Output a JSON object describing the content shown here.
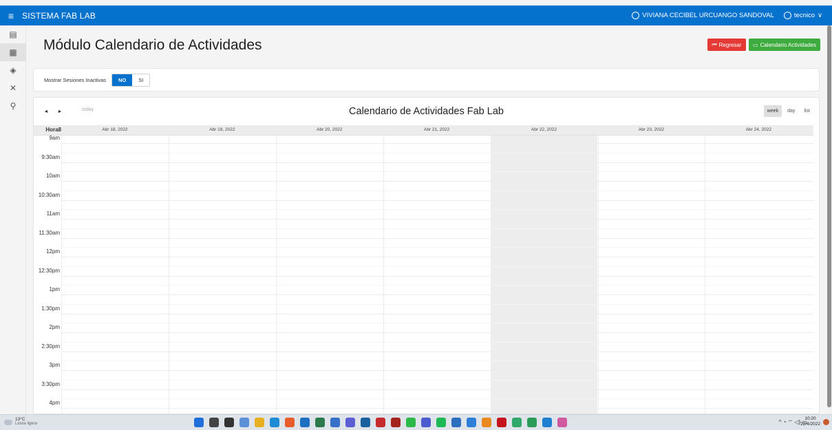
{
  "header": {
    "menu_icon": "menu-icon",
    "app_title": "SISTEMA FAB LAB",
    "user_full_name": "VIVIANA CECIBEL URCUANGO SANDOVAL",
    "user_name": "tecnico",
    "chevron": "∨"
  },
  "sidenav": {
    "items": [
      {
        "icon": "home-icon"
      },
      {
        "icon": "list-icon"
      },
      {
        "icon": "layers-icon"
      },
      {
        "icon": "tools-icon"
      },
      {
        "icon": "users-icon"
      }
    ]
  },
  "page": {
    "title": "Módulo Calendario de Actividades",
    "back_button": "Regresar",
    "calendar_button": "Calendario Actividades",
    "back_color": "#e53935",
    "calendar_color": "#3eab3e"
  },
  "filter": {
    "label": "Mostrar Sesiones Inactivas",
    "options": [
      "NO",
      "SI"
    ],
    "selected": "NO"
  },
  "calendar": {
    "prev": "◄",
    "next": "►",
    "today": "today",
    "title": "Calendario de Actividades Fab Lab",
    "views": [
      "week",
      "day",
      "list"
    ],
    "active_view": "week",
    "hour_header": "Hora8",
    "days": [
      "Abr 18, 2022",
      "Abr 19, 2022",
      "Abr 20, 2022",
      "Abr 21, 2022",
      "Abr 22, 2022",
      "Abr 23, 2022",
      "Abr 24, 2022"
    ],
    "highlighted_day": "Abr 22, 2022",
    "times": [
      "9am",
      "9:30am",
      "10am",
      "10:30am",
      "11am",
      "11:30am",
      "12pm",
      "12:30pm",
      "1pm",
      "1:30pm",
      "2pm",
      "2:30pm",
      "3pm",
      "3:30pm",
      "4pm"
    ]
  },
  "taskbar": {
    "temperature": "13°C",
    "condition": "Lluvia ligera",
    "time": "10:20",
    "date": "22/4/2022",
    "tray_icons": "^ ◔ ⌔ ◁) ▭",
    "app_colors": [
      "#1e6fd9",
      "#444444",
      "#333333",
      "#5b8fd6",
      "#e8b020",
      "#1f8bd6",
      "#e85c2b",
      "#1d6fc2",
      "#2a7a4a",
      "#3471c7",
      "#5c5fd3",
      "#1a5f9e",
      "#c62a2a",
      "#a3241d",
      "#2bb94a",
      "#4d5bd0",
      "#1db954",
      "#2c6fbe",
      "#2d7fd8",
      "#e98a1e",
      "#c4141c",
      "#2fa86a",
      "#2a9c58",
      "#1f7fd0",
      "#d05aa0"
    ]
  }
}
